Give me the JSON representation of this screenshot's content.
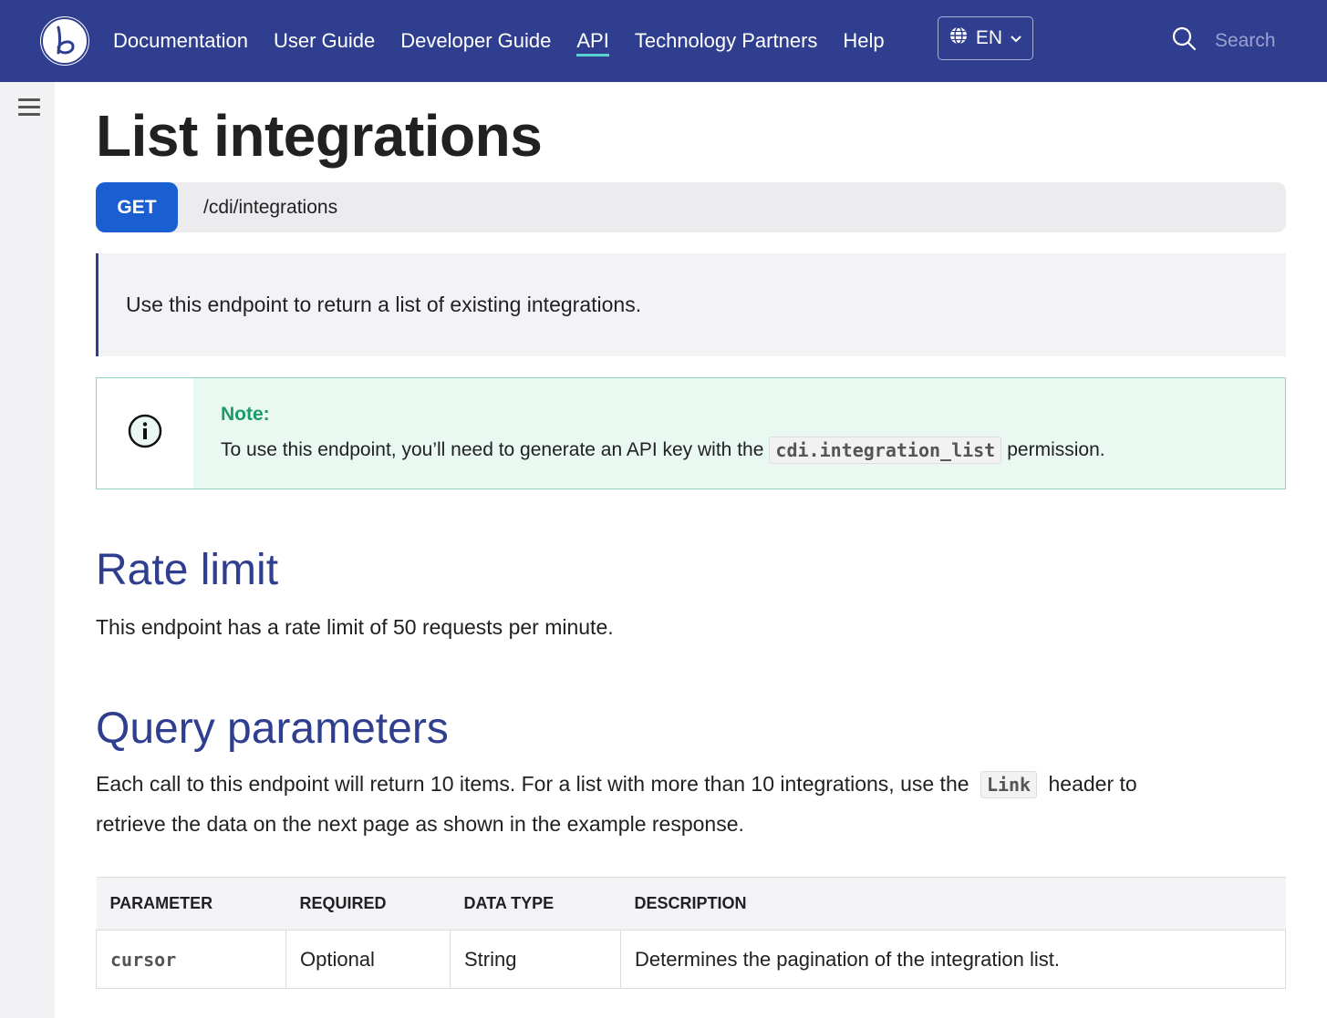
{
  "nav": {
    "items": [
      {
        "label": "Documentation",
        "active": false
      },
      {
        "label": "User Guide",
        "active": false
      },
      {
        "label": "Developer Guide",
        "active": false
      },
      {
        "label": "API",
        "active": true
      },
      {
        "label": "Technology Partners",
        "active": false
      },
      {
        "label": "Help",
        "active": false
      }
    ],
    "language": "EN",
    "search_placeholder": "Search",
    "accent_color": "#2f3e8f",
    "active_underline_color": "#5ad3d0"
  },
  "page": {
    "title": "List integrations",
    "method": "GET",
    "path": "/cdi/integrations",
    "description": "Use this endpoint to return a list of existing integrations.",
    "note": {
      "title": "Note:",
      "text_before": "To use this endpoint, you’ll need to generate an API key with the",
      "code": "cdi.integration_list",
      "text_after": "permission."
    },
    "rate_limit": {
      "heading": "Rate limit",
      "text": "This endpoint has a rate limit of 50 requests per minute."
    },
    "query_params": {
      "heading": "Query parameters",
      "text_before": "Each call to this endpoint will return 10 items. For a list with more than 10 integrations, use the",
      "code": "Link",
      "text_after_line1": "header to",
      "text_line2": "retrieve the data on the next page as shown in the example response.",
      "table": {
        "headers": [
          "PARAMETER",
          "REQUIRED",
          "DATA TYPE",
          "DESCRIPTION"
        ],
        "rows": [
          {
            "parameter": "cursor",
            "required": "Optional",
            "data_type": "String",
            "description": "Determines the pagination of the integration list."
          }
        ]
      }
    }
  }
}
